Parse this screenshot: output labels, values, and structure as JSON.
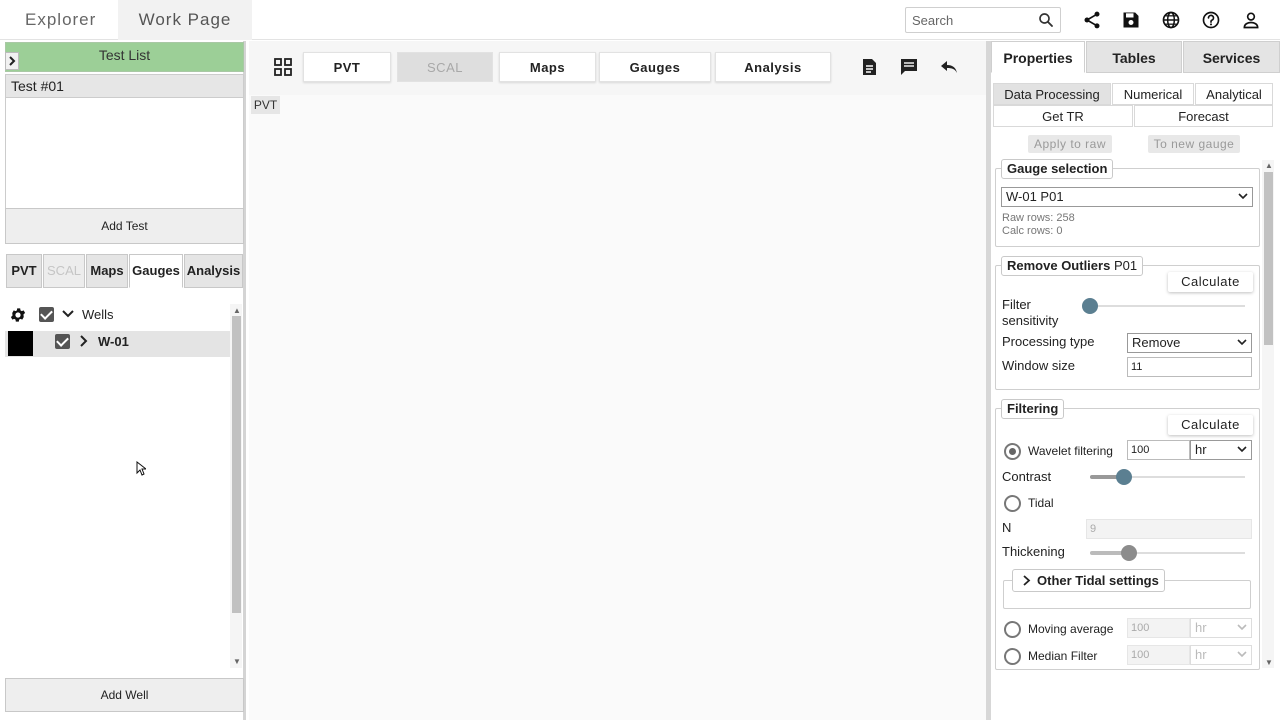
{
  "topbar": {
    "nav": [
      "Explorer",
      "Work Page"
    ],
    "search_placeholder": "Search",
    "icons": [
      "share-icon",
      "save-icon",
      "globe-icon",
      "help-icon",
      "user-icon"
    ]
  },
  "left": {
    "test_list_title": "Test List",
    "collapse_glyph": ">",
    "tests": [
      "Test #01"
    ],
    "add_test_label": "Add Test",
    "tabs": [
      "PVT",
      "SCAL",
      "Maps",
      "Gauges",
      "Analysis"
    ],
    "wells_label": "Wells",
    "well_name": "W-01",
    "well_color": "#000000",
    "add_well_label": "Add Well"
  },
  "center": {
    "tabs": [
      "PVT",
      "SCAL",
      "Maps",
      "Gauges",
      "Analysis"
    ],
    "active_view_label": "PVT"
  },
  "right": {
    "tabs": [
      "Properties",
      "Tables",
      "Services"
    ],
    "subtabs_row1": [
      "Data Processing",
      "Numerical",
      "Analytical"
    ],
    "subtabs_row2": [
      "Get TR",
      "Forecast"
    ],
    "apply_to_raw": "Apply to raw",
    "to_new_gauge": "To new gauge",
    "gauge_selection": {
      "title": "Gauge selection",
      "selected": "W-01 P01",
      "raw_rows": "Raw rows: 258",
      "calc_rows": "Calc rows: 0"
    },
    "remove_outliers": {
      "title": "Remove Outliers",
      "title_suffix": "P01",
      "calculate": "Calculate",
      "filter_sensitivity_label": "Filter sensitivity",
      "filter_sensitivity_value": 0,
      "processing_type_label": "Processing type",
      "processing_type_value": "Remove",
      "window_size_label": "Window size",
      "window_size_value": "11"
    },
    "filtering": {
      "title": "Filtering",
      "calculate": "Calculate",
      "wavelet_label": "Wavelet filtering",
      "wavelet_value": "100",
      "wavelet_unit": "hr",
      "contrast_label": "Contrast",
      "contrast_value": 0.22,
      "tidal_label": "Tidal",
      "n_label": "N",
      "n_value": "9",
      "thickening_label": "Thickening",
      "thickening_value": 0.25,
      "other_tidal_label": "Other Tidal settings",
      "moving_average_label": "Moving average",
      "moving_average_value": "100",
      "moving_average_unit": "hr",
      "median_filter_label": "Median Filter",
      "median_filter_value": "100",
      "median_filter_unit": "hr"
    }
  },
  "colors": {
    "test_list_header": "#9ccf97",
    "slider_thumb": "#5b7f91",
    "accent_grey": "#555555"
  }
}
